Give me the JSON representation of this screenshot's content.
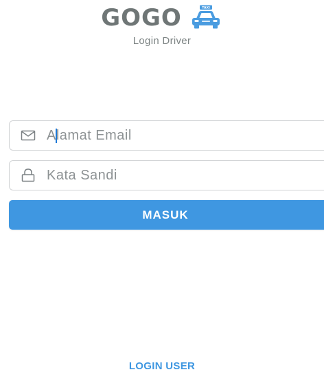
{
  "header": {
    "title": "GOGO",
    "subtitle": "Login Driver",
    "logo_icon": "taxi-icon",
    "logo_sign_text": "TAXI"
  },
  "form": {
    "email": {
      "icon": "mail-icon",
      "placeholder": "Alamat Email",
      "value": ""
    },
    "password": {
      "icon": "lock-icon",
      "placeholder": "Kata Sandi",
      "value": ""
    },
    "submit_label": "MASUK"
  },
  "footer": {
    "login_user_label": "LOGIN USER"
  },
  "colors": {
    "brand_text": "#6f7676",
    "accent": "#3f97e1",
    "field_border": "#d2d4d6",
    "placeholder": "#8d9294"
  }
}
